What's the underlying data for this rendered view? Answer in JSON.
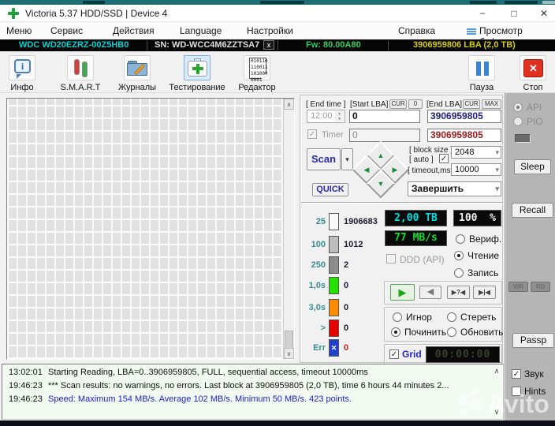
{
  "colors": {
    "lcd_cyan": "#00e0e0",
    "lcd_green": "#15dc30",
    "lcd_white": "#f0f0f0",
    "lcd_dim": "#39412f",
    "model_cyan": "#00d4d4",
    "serial_white": "#e0e0e0",
    "fw_green": "#35d060",
    "lba_yellow": "#d8cc10",
    "log_blue": "#2020cc",
    "err_red": "#cc2020",
    "accent_blue": "#2222bb"
  },
  "icons": {
    "minimize": "−",
    "maximize": "□",
    "close": "✕",
    "check": "✓",
    "dropdown": "▾",
    "spin_up": "▲",
    "spin_down": "▼",
    "nav_up": "▲",
    "nav_left": "◀",
    "nav_right": "▶",
    "nav_down": "▼",
    "play": "▶",
    "rewind": "◀",
    "seek_question": "▶?◀",
    "seek_edge": "▶|◀",
    "scroll_up": "∧",
    "scroll_down": "∨",
    "info": "i",
    "stop": "✕",
    "err_x": "✕",
    "device_close": "x",
    "editor_bits": [
      "010110",
      "110011",
      "101000",
      "0001"
    ]
  },
  "titlebar": {
    "title": "Victoria 5.37 HDD/SSD | Device 4"
  },
  "menu": {
    "items": [
      "Меню",
      "Сервис",
      "Действия",
      "Language",
      "Настройки",
      "Справка"
    ],
    "buffer_view": "Просмотр буфера"
  },
  "device_bar": {
    "model": "WDC WD20EZRZ-00Z5HB0",
    "serial": "SN: WD-WCC4M6ZZTSA7",
    "firmware": "Fw: 80.00A80",
    "capacity": "3906959806 LBA (2,0 TB)"
  },
  "toolbar": {
    "info": "Инфо",
    "smart": "S.M.A.R.T",
    "logs": "Журналы",
    "test": "Тестирование",
    "editor": "Редактор",
    "pause": "Пауза",
    "stop": "Стоп"
  },
  "controls": {
    "end_time_label": "[ End time ]",
    "end_time": "12:00",
    "timer_label": "Timer",
    "start_lba_label": "[Start LBA]",
    "cur_label": "CUR",
    "zero_label": "0",
    "end_lba_label": "[End LBA]",
    "max_label": "MAX",
    "start_lba": "0",
    "end_lba": "3906959805",
    "start_lba_current": "0",
    "end_lba_current": "3906959805",
    "scan_label": "Scan",
    "quick_label": "QUICK",
    "block_size_label": "[ block size ]",
    "auto_label": "[ auto ]",
    "block_size": "2048",
    "timeout_label": "[ timeout,ms ]",
    "timeout": "10000",
    "on_end_action": "Завершить"
  },
  "histogram": {
    "rows": [
      {
        "label": "25",
        "value": "1906683",
        "color": "#f8f8f8"
      },
      {
        "label": "100",
        "value": "1012",
        "color": "#bdbdbd"
      },
      {
        "label": "250",
        "value": "2",
        "color": "#8c8c8c"
      },
      {
        "label": "1,0s",
        "value": "0",
        "color": "#28e000"
      },
      {
        "label": "3,0s",
        "value": "0",
        "color": "#ff8c00"
      },
      {
        "label": ">",
        "value": "0",
        "color": "#e80000"
      },
      {
        "label": "Err",
        "value": "0",
        "color": "#2040d0"
      }
    ]
  },
  "status": {
    "capacity": "2,00 TB",
    "percent": "100",
    "percent_unit": "%",
    "speed": "77 MB/s",
    "ddd_label": "DDD (API)",
    "mode_verify": "Вериф.",
    "mode_read": "Чтение",
    "mode_write": "Запись",
    "remap_ignore": "Игнор",
    "remap_erase": "Стереть",
    "remap_repair": "Починить",
    "remap_refresh": "Обновить",
    "grid_label": "Grid",
    "elapsed": "00:00:00"
  },
  "sidebar": {
    "api": "API",
    "pio": "PIO",
    "sleep": "Sleep",
    "recall": "Recall",
    "wr": "WR",
    "rd": "RD",
    "passp": "Passp"
  },
  "log": {
    "entries": [
      {
        "time": "13:02:01",
        "text": "Starting Reading, LBA=0..3906959805, FULL, sequential access, timeout 10000ms",
        "color": "#101010"
      },
      {
        "time": "19:46:23",
        "text": "*** Scan results: no warnings, no errors. Last block at 3906959805 (2,0 TB), time 6 hours 44 minutes 2...",
        "color": "#101010"
      },
      {
        "time": "19:46:23",
        "text": "Speed: Maximum 154 MB/s. Average 102 MB/s. Minimum 50 MB/s. 423 points.",
        "color": "#2020cc"
      }
    ],
    "sound_label": "Звук",
    "hints_label": "Hints"
  },
  "watermark": "Avito"
}
